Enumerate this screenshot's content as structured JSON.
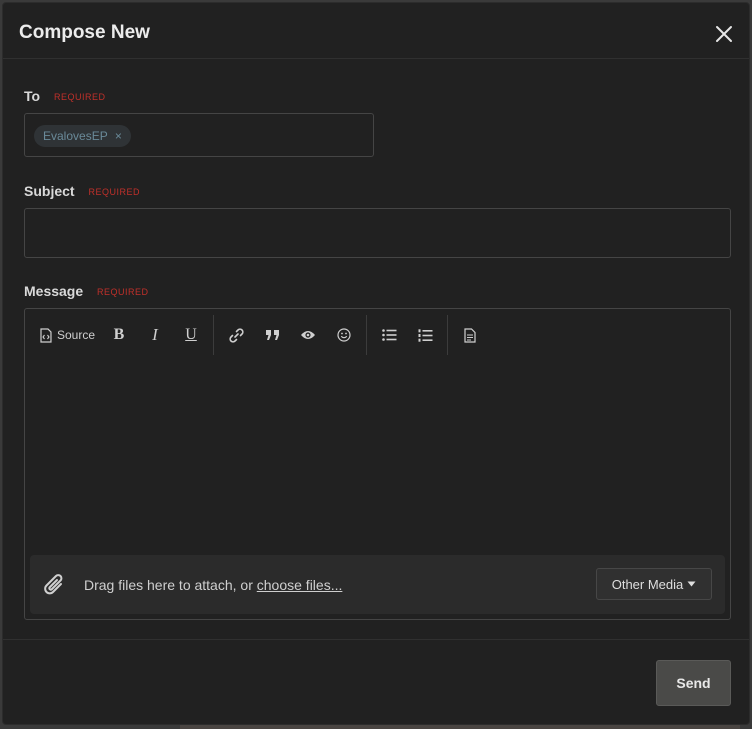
{
  "modal": {
    "title": "Compose New"
  },
  "fields": {
    "required_text": "REQUIRED",
    "to_label": "To",
    "to_recipients": [
      "EvalovesEP"
    ],
    "to_remove_glyph": "×",
    "subject_label": "Subject",
    "subject_value": "",
    "message_label": "Message"
  },
  "toolbar": {
    "source_label": "Source",
    "bold_label": "B",
    "italic_label": "I",
    "underline_label": "U"
  },
  "attach": {
    "text": "Drag files here to attach, or ",
    "link": "choose files...",
    "media_button": "Other Media"
  },
  "footer": {
    "send_label": "Send"
  },
  "icons": {
    "close": "close-icon",
    "source": "source-code-icon",
    "link": "link-icon",
    "quote": "quote-icon",
    "preview": "eye-icon",
    "emoji": "smiley-icon",
    "bullets": "bulleted-list-icon",
    "numbers": "numbered-list-icon",
    "draft": "document-icon",
    "attach": "paperclip-icon",
    "dropdown": "caret-down-icon"
  },
  "colors": {
    "background": "#212121",
    "required": "#c0302a",
    "tag_text": "#6a8a99",
    "send_button": "#4a4a48"
  }
}
